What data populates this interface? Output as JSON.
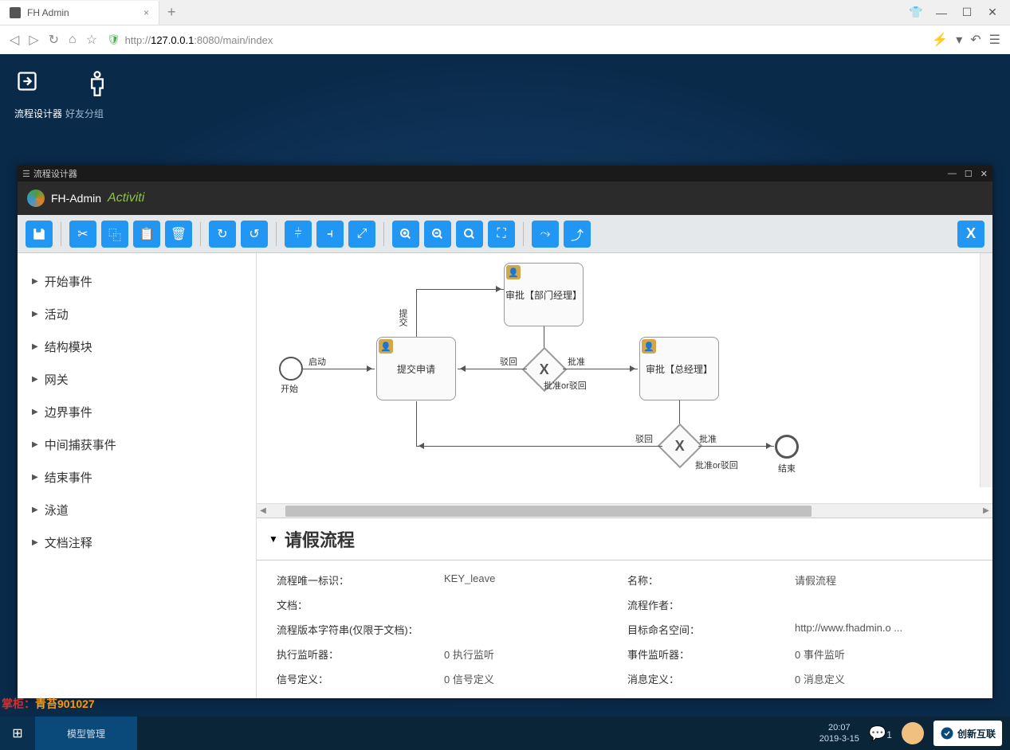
{
  "browser": {
    "tab_title": "FH Admin",
    "url_proto": "http://",
    "url_ip": "127.0.0.1",
    "url_port": ":8080",
    "url_path": "/main/index"
  },
  "app_tabs": {
    "designer": "流程设计器",
    "friends": "好友分组"
  },
  "inner_window": {
    "title": "流程设计器",
    "brand": "FH-Admin",
    "brand_suffix": "Activiti"
  },
  "palette": {
    "items": [
      "开始事件",
      "活动",
      "结构模块",
      "网关",
      "边界事件",
      "中间捕获事件",
      "结束事件",
      "泳道",
      "文档注释"
    ]
  },
  "diagram": {
    "start_label": "开始",
    "end_label": "结束",
    "task_submit": "提交申请",
    "task_dept_mgr": "审批【部门经理】",
    "task_gen_mgr": "审批【总经理】",
    "gateway_label_1": "批准or驳回",
    "gateway_label_2": "批准or驳回",
    "edge_launch": "启动",
    "edge_submit": "提交",
    "edge_reject_1": "驳回",
    "edge_approve_1": "批准",
    "edge_reject_2": "驳回",
    "edge_approve_2": "批准"
  },
  "props": {
    "title": "请假流程",
    "rows": {
      "key_label": "流程唯一标识：",
      "key_val": "KEY_leave",
      "name_label": "名称：",
      "name_val": "请假流程",
      "doc_label": "文档：",
      "doc_val": "",
      "author_label": "流程作者：",
      "author_val": "",
      "ver_label": "流程版本字符串(仅限于文档)：",
      "ver_val": "",
      "ns_label": "目标命名空间：",
      "ns_val": "http://www.fhadmin.o ...",
      "exec_label": "执行监听器：",
      "exec_val": "0 执行监听",
      "event_label": "事件监听器：",
      "event_val": "0 事件监听",
      "sig_label": "信号定义：",
      "sig_val": "0 信号定义",
      "msg_label": "消息定义：",
      "msg_val": "0 消息定义"
    }
  },
  "watermark": {
    "a": "掌柜：",
    "b": "青苔901027"
  },
  "taskbar": {
    "item": "模型管理",
    "time": "20:07",
    "date": "2019-3-15",
    "chat_count": "1",
    "company": "创新互联"
  }
}
